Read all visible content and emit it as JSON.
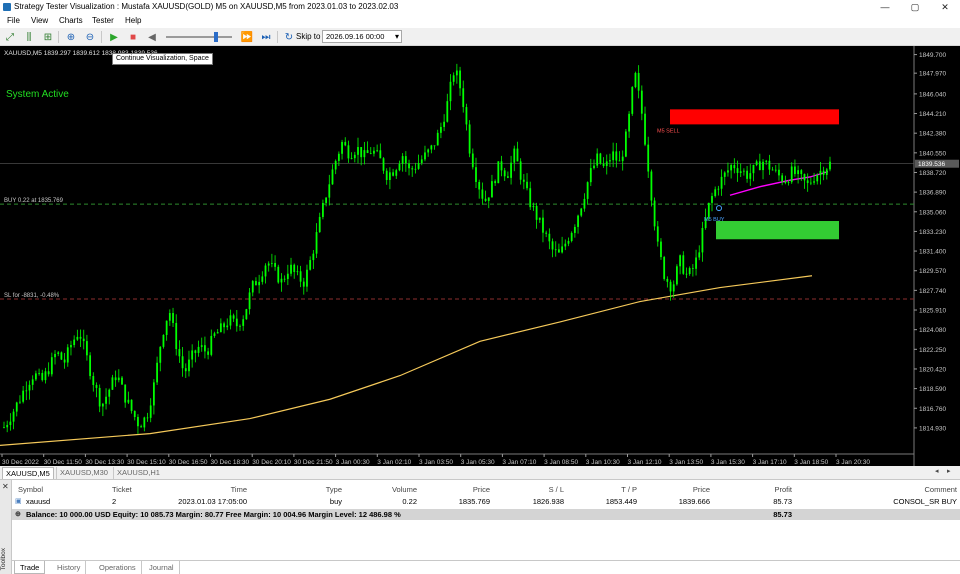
{
  "window": {
    "title": "Strategy Tester Visualization : Mustafa XAUUSD(GOLD) M5 on XAUUSD,M5 from 2023.01.03 to 2023.02.03",
    "minimize": "—",
    "maximize": "▢",
    "close": "✕"
  },
  "menu": [
    "File",
    "View",
    "Charts",
    "Tester",
    "Help"
  ],
  "toolbar": {
    "skip_to_label": "Skip to",
    "skip_to_value": "2026.09.16 00:00",
    "tooltip": "Continue Visualization, Space"
  },
  "chart": {
    "header": "XAUUSD,M5  1839.297 1839.612 1838.983 1839.536",
    "status": "System Active",
    "buy_line_label": "BUY 0.22 at 1835.769",
    "sl_line_label": "SL for -8831, -0.48%",
    "trade_marker_label": "M5 BUY",
    "sell_zone_label": "M5 SELL",
    "current_price": "1839.536",
    "colors": {
      "candle": "#00ff00",
      "background": "#000000",
      "ma_slow": "#f5c95a",
      "ma_fast": "#ff00ff",
      "sell_zone": "#ff0000",
      "buy_zone": "#33cc33",
      "buy_line": "#2e8b2e",
      "sl_line": "#8b2e2e"
    }
  },
  "chart_data": {
    "type": "candlestick",
    "symbol": "XAUUSD,M5",
    "ohlc_last": {
      "open": 1839.297,
      "high": 1839.612,
      "low": 1838.983,
      "close": 1839.536
    },
    "ylim": [
      1812.5,
      1850.5
    ],
    "y_ticks": [
      "1849.700",
      "1847.970",
      "1846.040",
      "1844.210",
      "1842.380",
      "1840.550",
      "1838.720",
      "1836.890",
      "1835.060",
      "1833.230",
      "1831.400",
      "1829.570",
      "1827.740",
      "1825.910",
      "1824.080",
      "1822.250",
      "1820.420",
      "1818.590",
      "1816.760",
      "1814.930"
    ],
    "x_ticks": [
      "30 Dec 2022",
      "30 Dec 11:50",
      "30 Dec 13:30",
      "30 Dec 15:10",
      "30 Dec 16:50",
      "30 Dec 18:30",
      "30 Dec 20:10",
      "30 Dec 21:50",
      "3 Jan 00:30",
      "3 Jan 02:10",
      "3 Jan 03:50",
      "3 Jan 05:30",
      "3 Jan 07:10",
      "3 Jan 08:50",
      "3 Jan 10:30",
      "3 Jan 12:10",
      "3 Jan 13:50",
      "3 Jan 15:30",
      "3 Jan 17:10",
      "3 Jan 18:50",
      "3 Jan 20:30"
    ],
    "close_path": [
      1815.0,
      1816.2,
      1817.5,
      1819.0,
      1820.0,
      1819.2,
      1820.5,
      1822.0,
      1821.0,
      1822.8,
      1824.0,
      1821.5,
      1819.0,
      1817.0,
      1818.5,
      1820.0,
      1818.0,
      1816.5,
      1815.2,
      1816.0,
      1819.0,
      1823.5,
      1826.0,
      1822.5,
      1820.0,
      1821.5,
      1822.5,
      1822.0,
      1823.5,
      1824.2,
      1825.0,
      1824.5,
      1825.5,
      1828.0,
      1829.0,
      1830.5,
      1829.5,
      1828.5,
      1830.0,
      1829.0,
      1828.5,
      1831.0,
      1834.0,
      1837.0,
      1839.5,
      1841.5,
      1840.5,
      1841.0,
      1840.2,
      1840.8,
      1840.0,
      1838.5,
      1839.0,
      1840.5,
      1838.8,
      1839.5,
      1840.2,
      1841.0,
      1842.5,
      1845.0,
      1848.5,
      1846.0,
      1841.0,
      1838.0,
      1836.0,
      1837.5,
      1839.5,
      1838.5,
      1840.5,
      1838.0,
      1836.0,
      1834.5,
      1833.0,
      1831.5,
      1831.0,
      1832.5,
      1834.0,
      1836.0,
      1838.5,
      1840.0,
      1839.0,
      1840.5,
      1839.5,
      1842.5,
      1848.0,
      1844.0,
      1838.0,
      1832.0,
      1829.0,
      1828.0,
      1830.5,
      1829.0,
      1830.0,
      1833.0,
      1836.0,
      1837.5,
      1838.5,
      1839.5,
      1839.0,
      1838.5,
      1839.0,
      1839.8,
      1839.2,
      1838.5,
      1838.0,
      1838.8,
      1838.2,
      1837.5,
      1838.5,
      1839.0,
      1839.536
    ],
    "ma_slow": [
      [
        0,
        1813.3
      ],
      [
        150,
        1814.4
      ],
      [
        250,
        1815.8
      ],
      [
        330,
        1817.6
      ],
      [
        400,
        1819.8
      ],
      [
        480,
        1823.0
      ],
      [
        560,
        1824.8
      ],
      [
        640,
        1826.7
      ],
      [
        720,
        1828.0
      ],
      [
        812,
        1829.1
      ]
    ],
    "ma_fast": [
      [
        730,
        1836.6
      ],
      [
        760,
        1837.4
      ],
      [
        790,
        1838.0
      ],
      [
        810,
        1838.3
      ],
      [
        828,
        1838.8
      ]
    ],
    "levels": {
      "buy": 1835.769,
      "sl": 1826.938,
      "current": 1839.536
    },
    "zones": {
      "sell": [
        1843.2,
        1844.6
      ],
      "buy": [
        1832.5,
        1834.2
      ]
    }
  },
  "tabs": [
    "XAUUSD,M5",
    "XAUUSD,M30",
    "XAUUSD,H1"
  ],
  "trades": {
    "headers": [
      "Symbol",
      "Ticket",
      "Time",
      "Type",
      "Volume",
      "Price",
      "S / L",
      "T / P",
      "Price",
      "Profit",
      "Comment"
    ],
    "rows": [
      [
        "xauusd",
        "2",
        "2023.01.03 17:05:00",
        "buy",
        "0.22",
        "1835.769",
        "1826.938",
        "1853.449",
        "1839.666",
        "85.73",
        "CONSOL_SR BUY"
      ]
    ],
    "balance_line": "Balance: 10 000.00 USD  Equity: 10 085.73  Margin: 80.77  Free Margin: 10 004.96  Margin Level: 12 486.98 %",
    "balance_profit": "85.73"
  },
  "toolbox": {
    "label": "Toolbox",
    "close": "✕",
    "tabs": [
      "Trade",
      "History",
      "Operations",
      "Journal"
    ]
  }
}
